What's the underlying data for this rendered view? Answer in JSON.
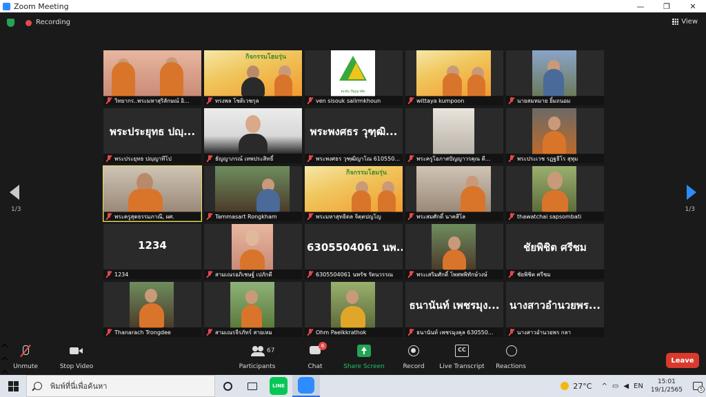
{
  "window": {
    "title": "Zoom Meeting",
    "minimize": "—",
    "restore": "❐",
    "close": "✕"
  },
  "topbar": {
    "recording_label": "Recording",
    "view_label": "View"
  },
  "gallery": {
    "page_left": "1/3",
    "page_right": "1/3",
    "tiles": [
      {
        "name": "วิทยากร..พระมหาสุริลักษณ์ อิ...",
        "big": ""
      },
      {
        "name": "ทรงพล โชติเวชกุล",
        "big": ""
      },
      {
        "name": "ven sisouk salirmkhoun",
        "big": ""
      },
      {
        "name": "wittaya kumpoon",
        "big": ""
      },
      {
        "name": "นายสมหมาย ยิ้มถนอม",
        "big": ""
      },
      {
        "name": "พระประยุทธ ปญฺญาทีโป",
        "big": "พระประยุทธ ปญฺ..."
      },
      {
        "name": "ธัญญาภรณ์ เทพประสิทธิ์",
        "big": ""
      },
      {
        "name": "พระพงศธร วุฑฺฒิญาโณ 610550...",
        "big": "พระพงศธร วุฑฺฒิ..."
      },
      {
        "name": "พระครูโอภาสปัญญาวรคุณ ดี...",
        "big": ""
      },
      {
        "name": "พระประเวช รฏฐธีโร สุหุม",
        "big": ""
      },
      {
        "name": "พระครูสุตธรรมภาณี, ผศ.",
        "big": ""
      },
      {
        "name": "Tammasart Rongkham",
        "big": ""
      },
      {
        "name": "พระมหาสุทธิดล จิตฺตปญโญ",
        "big": ""
      },
      {
        "name": "พระสมศักดิ์ นาคสีโล",
        "big": ""
      },
      {
        "name": "thawatchai sapsombati",
        "big": ""
      },
      {
        "name": "1234",
        "big": "1234"
      },
      {
        "name": "สามเณรอภิเชษฐ์ เปภักดี",
        "big": ""
      },
      {
        "name": "6305504061 นพรัช รัตนวรรณ",
        "big": "6305504061 นพ..."
      },
      {
        "name": "พระเสริมศักดิ์ โพสพพิทักษ์วงษ์",
        "big": ""
      },
      {
        "name": "ชัยพิชิต ศรีชม",
        "big": "ชัยพิชิต ศรีชม"
      },
      {
        "name": "Thanarach Trongdee",
        "big": ""
      },
      {
        "name": "สามเณรจีรภัทร์ สายเหม",
        "big": ""
      },
      {
        "name": "Ohm Paelkkrathok",
        "big": ""
      },
      {
        "name": "ธนานันท์ เพชรมุงคุล 630550...",
        "big": "ธนานันท์ เพชรมุง..."
      },
      {
        "name": "นางสาวอำนวยพร กลา",
        "big": "นางสาวอำนวยพร..."
      }
    ],
    "poster_title": "กิจกรรมโฮมรุ่น",
    "logo_caption": "ตะลัน ปัญญาคิด"
  },
  "toolbar": {
    "unmute": "Unmute",
    "stop_video": "Stop Video",
    "participants": "Participants",
    "participants_count": "67",
    "chat": "Chat",
    "chat_badge": "6",
    "share_screen": "Share Screen",
    "record": "Record",
    "live_transcript": "Live Transcript",
    "cc_label": "CC",
    "reactions": "Reactions",
    "leave": "Leave"
  },
  "taskbar": {
    "search_placeholder": "พิมพ์ที่นี่เพื่อค้นหา",
    "line_label": "LINE",
    "temperature": "27°C",
    "time": "15:01",
    "date": "19/1/2565",
    "notification_count": "5",
    "lang": "EN"
  },
  "colors": {
    "accent_blue": "#2d8cff",
    "share_green": "#23a455",
    "leave_red": "#d83a2e",
    "active_speaker": "#e9e15a"
  }
}
